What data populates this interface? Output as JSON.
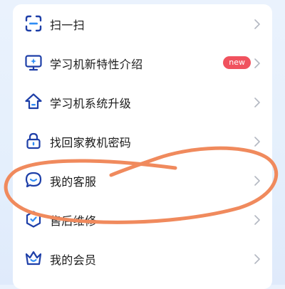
{
  "colors": {
    "accent": "#1e3fa8",
    "badge": "#f0525e",
    "chevron": "#b3b8c2",
    "annotation": "#f08a5d"
  },
  "menu": {
    "items": [
      {
        "label": "扫一扫",
        "icon": "scan-icon"
      },
      {
        "label": "学习机新特性介绍",
        "icon": "monitor-icon",
        "badge": "new"
      },
      {
        "label": "学习机系统升级",
        "icon": "upgrade-house-icon"
      },
      {
        "label": "找回家教机密码",
        "icon": "lock-icon"
      },
      {
        "label": "我的客服",
        "icon": "chat-smile-icon"
      },
      {
        "label": "售后维修",
        "icon": "repair-icon"
      },
      {
        "label": "我的会员",
        "icon": "crown-icon"
      }
    ]
  },
  "annotation": {
    "type": "hand-drawn-circle",
    "target": "我的客服"
  }
}
